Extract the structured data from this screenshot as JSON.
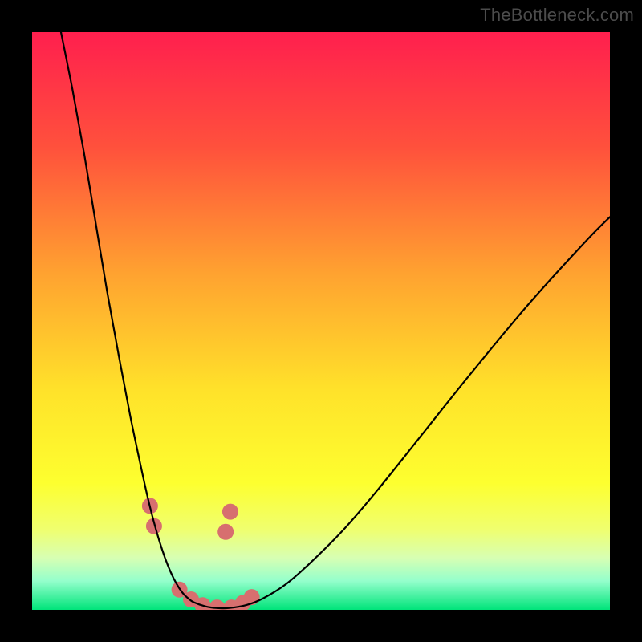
{
  "watermark": {
    "text": "TheBottleneck.com"
  },
  "chart_data": {
    "type": "line",
    "title": "",
    "xlabel": "",
    "ylabel": "",
    "xlim": [
      0,
      100
    ],
    "ylim": [
      0,
      100
    ],
    "grid": false,
    "legend": false,
    "gradient_stops": [
      {
        "offset": 0,
        "color": "#ff1f4e"
      },
      {
        "offset": 20,
        "color": "#ff513c"
      },
      {
        "offset": 42,
        "color": "#ffa330"
      },
      {
        "offset": 62,
        "color": "#ffe22a"
      },
      {
        "offset": 78,
        "color": "#fdff2f"
      },
      {
        "offset": 86,
        "color": "#f0ff6e"
      },
      {
        "offset": 91,
        "color": "#d7ffb3"
      },
      {
        "offset": 95,
        "color": "#94ffcc"
      },
      {
        "offset": 100,
        "color": "#00e47a"
      }
    ],
    "series": [
      {
        "name": "bottleneck-curve",
        "color": "#000000",
        "stroke_width": 2.2,
        "x": [
          5,
          7,
          9,
          11,
          13,
          15,
          17,
          19,
          20,
          21,
          22,
          23,
          24,
          25,
          26,
          27,
          28,
          30,
          32,
          34,
          37,
          40,
          44,
          48,
          54,
          60,
          68,
          76,
          86,
          96,
          100
        ],
        "y": [
          100,
          90,
          79,
          67,
          55,
          44,
          33.5,
          24,
          19.5,
          15.5,
          12,
          9,
          6.5,
          4.5,
          3,
          2,
          1.3,
          0.6,
          0.3,
          0.3,
          0.8,
          2,
          4.5,
          8,
          14,
          21,
          31,
          41,
          53,
          64,
          68
        ]
      }
    ],
    "markers": [
      {
        "name": "highlight-dots",
        "color": "#d76f6f",
        "radius": 10,
        "points": [
          {
            "x": 20.4,
            "y": 18
          },
          {
            "x": 21.1,
            "y": 14.5
          },
          {
            "x": 25.5,
            "y": 3.5
          },
          {
            "x": 27.5,
            "y": 1.8
          },
          {
            "x": 29.5,
            "y": 0.8
          },
          {
            "x": 32.0,
            "y": 0.4
          },
          {
            "x": 34.5,
            "y": 0.4
          },
          {
            "x": 36.5,
            "y": 1.2
          },
          {
            "x": 38.0,
            "y": 2.2
          },
          {
            "x": 33.5,
            "y": 13.5
          },
          {
            "x": 34.3,
            "y": 17.0
          }
        ]
      }
    ]
  }
}
